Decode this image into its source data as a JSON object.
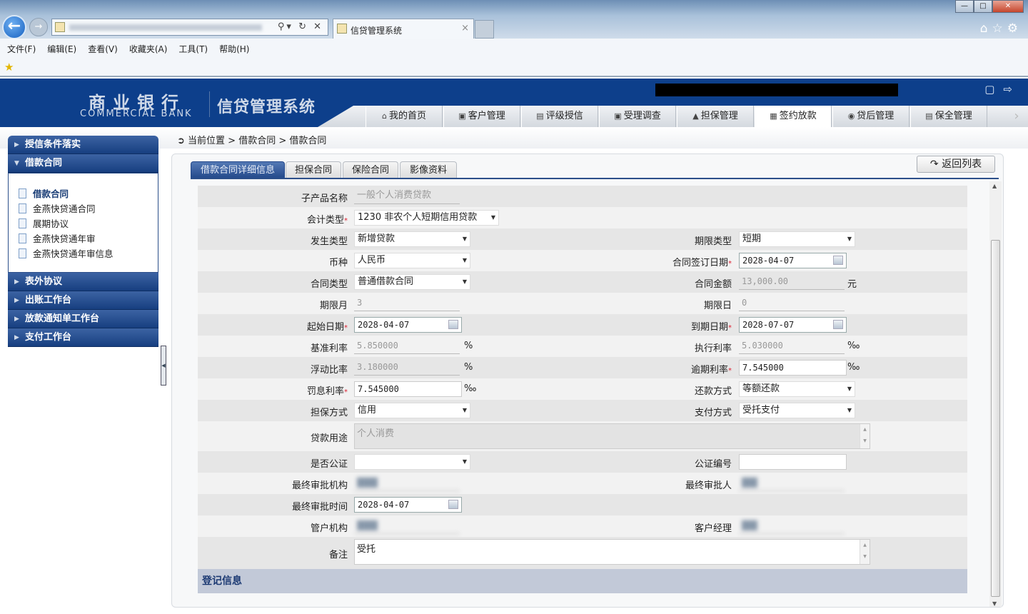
{
  "browser": {
    "tab_title": "信贷管理系统",
    "menu": [
      "文件(F)",
      "编辑(E)",
      "查看(V)",
      "收藏夹(A)",
      "工具(T)",
      "帮助(H)"
    ]
  },
  "header": {
    "logo_cn": "商业银行",
    "logo_en": "COMMERCIAL BANK",
    "system_name": "信贷管理系统",
    "nav": [
      {
        "label": "我的首页",
        "icon": "home-icon"
      },
      {
        "label": "客户管理",
        "icon": "customer-icon"
      },
      {
        "label": "评级授信",
        "icon": "rating-icon"
      },
      {
        "label": "受理调查",
        "icon": "survey-icon"
      },
      {
        "label": "担保管理",
        "icon": "guarantee-icon"
      },
      {
        "label": "签约放款",
        "icon": "contract-icon",
        "active": true
      },
      {
        "label": "贷后管理",
        "icon": "postloan-icon"
      },
      {
        "label": "保全管理",
        "icon": "preservation-icon"
      }
    ]
  },
  "sidebar": {
    "groups_top": [
      "授信条件落实",
      "借款合同"
    ],
    "items": [
      "借款合同",
      "金燕快贷通合同",
      "展期协议",
      "金燕快贷通年审",
      "金燕快贷通年审信息"
    ],
    "groups_bottom": [
      "表外协议",
      "出账工作台",
      "放款通知单工作台",
      "支付工作台"
    ]
  },
  "breadcrumb": "当前位置 > 借款合同 > 借款合同",
  "tabs": [
    "借款合同详细信息",
    "担保合同",
    "保险合同",
    "影像资料"
  ],
  "back_button": "返回列表",
  "form": {
    "rows": [
      {
        "l": {
          "label": "子产品名称",
          "type": "rotxt",
          "value": "一般个人消费贷款"
        }
      },
      {
        "l": {
          "label": "会计类型",
          "req": true,
          "type": "select",
          "value": "1230 非农个人短期信用贷款",
          "wide": true
        }
      },
      {
        "l": {
          "label": "发生类型",
          "type": "select",
          "value": "新增贷款"
        },
        "r": {
          "label": "期限类型",
          "type": "select",
          "value": "短期"
        }
      },
      {
        "l": {
          "label": "币种",
          "type": "select",
          "value": "人民币"
        },
        "r": {
          "label": "合同签订日期",
          "req": true,
          "type": "date",
          "value": "2028-04-07"
        }
      },
      {
        "l": {
          "label": "合同类型",
          "type": "select",
          "value": "普通借款合同"
        },
        "r": {
          "label": "合同金额",
          "type": "ro",
          "value": "13,000.00",
          "unit": "元"
        }
      },
      {
        "l": {
          "label": "期限月",
          "type": "ro",
          "value": "3"
        },
        "r": {
          "label": "期限日",
          "type": "ro",
          "value": "0"
        }
      },
      {
        "l": {
          "label": "起始日期",
          "req": true,
          "type": "date",
          "value": "2028-04-07"
        },
        "r": {
          "label": "到期日期",
          "req": true,
          "type": "date",
          "value": "2028-07-07"
        }
      },
      {
        "l": {
          "label": "基准利率",
          "type": "ro",
          "value": "5.850000",
          "unit": "%"
        },
        "r": {
          "label": "执行利率",
          "type": "ro",
          "value": "5.030000",
          "unit": "‰"
        }
      },
      {
        "l": {
          "label": "浮动比率",
          "type": "ro",
          "value": "3.180000",
          "unit": "%"
        },
        "r": {
          "label": "逾期利率",
          "req": true,
          "type": "input",
          "value": "7.545000",
          "unit": "‰"
        }
      },
      {
        "l": {
          "label": "罚息利率",
          "req": true,
          "type": "input",
          "value": "7.545000",
          "unit": "‰"
        },
        "r": {
          "label": "还款方式",
          "type": "select",
          "value": "等额还款"
        }
      },
      {
        "l": {
          "label": "担保方式",
          "type": "select",
          "value": "信用"
        },
        "r": {
          "label": "支付方式",
          "type": "select",
          "value": "受托支付"
        }
      },
      {
        "tall": 1,
        "l": {
          "label": "贷款用途",
          "type": "textarea",
          "value": "个人消费"
        }
      },
      {
        "l": {
          "label": "是否公证",
          "type": "select",
          "value": ""
        },
        "r": {
          "label": "公证编号",
          "type": "input",
          "value": ""
        }
      },
      {
        "l": {
          "label": "最终审批机构",
          "type": "blur",
          "value": "████"
        },
        "r": {
          "label": "最终审批人",
          "type": "blur",
          "value": "███"
        }
      },
      {
        "l": {
          "label": "最终审批时间",
          "type": "date",
          "value": "2028-04-07"
        }
      },
      {
        "l": {
          "label": "管户机构",
          "type": "blur",
          "value": "████"
        },
        "r": {
          "label": "客户经理",
          "type": "blur",
          "value": "███"
        }
      },
      {
        "tall": 2,
        "l": {
          "label": "备注",
          "type": "textarea-w",
          "value": "受托"
        }
      }
    ],
    "section": "登记信息"
  }
}
